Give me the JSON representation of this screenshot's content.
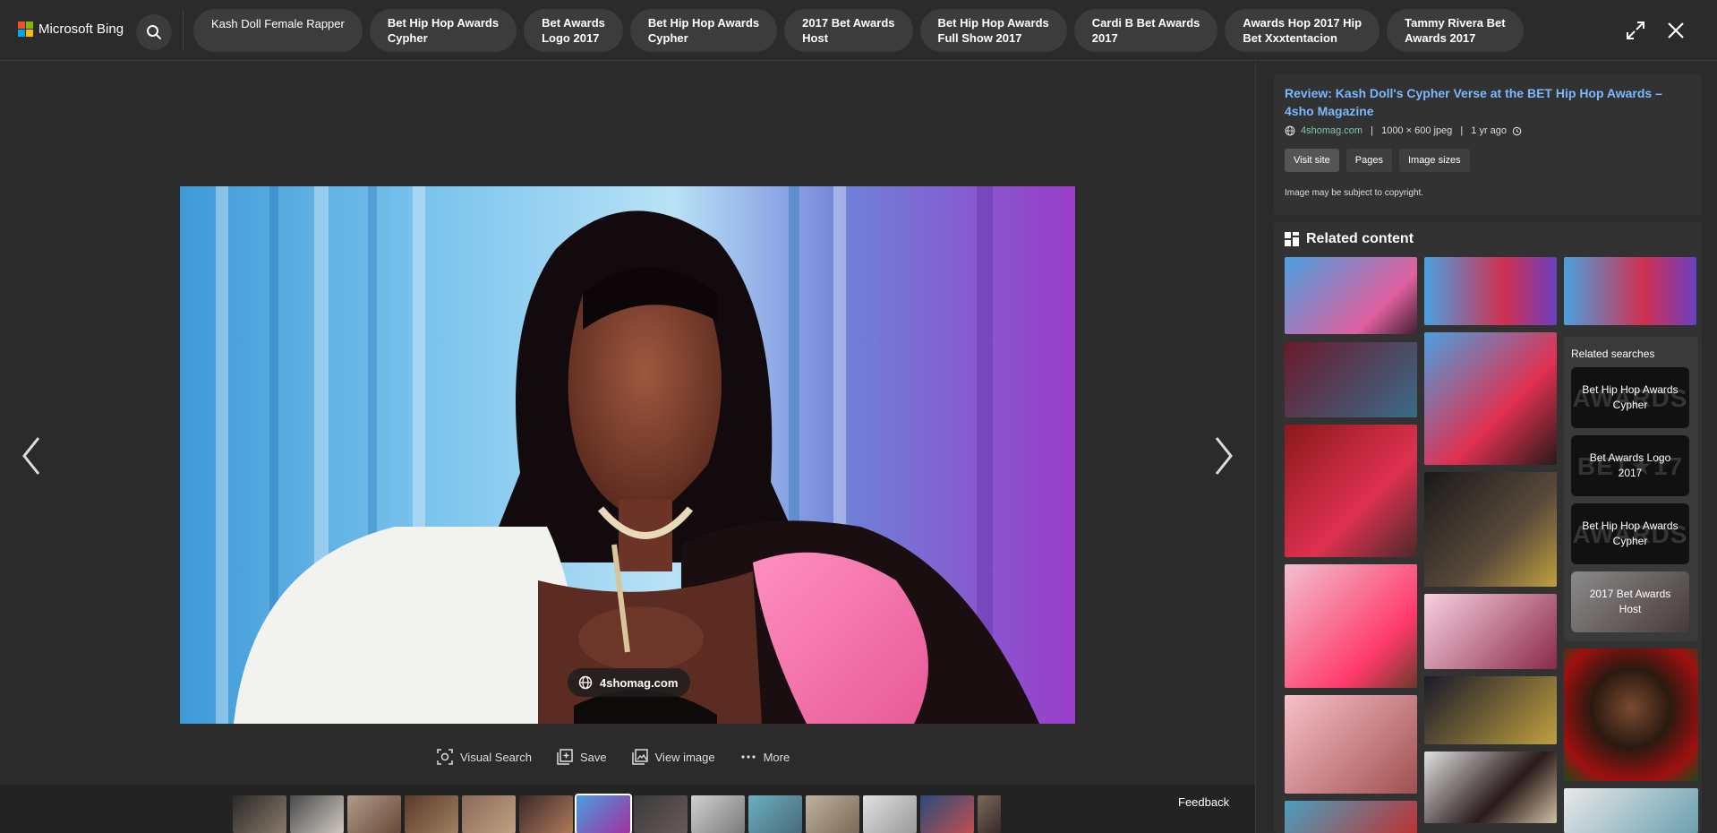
{
  "header": {
    "brand": "Microsoft Bing",
    "brand_colors": [
      "#f25022",
      "#7fba00",
      "#00a4ef",
      "#ffb900"
    ],
    "search_icon": "search-icon",
    "pills": [
      "Kash Doll Female Rapper",
      "Bet Hip Hop Awards\nCypher",
      "Bet Awards\nLogo 2017",
      "Bet Hip Hop Awards\nCypher",
      "2017 Bet Awards\nHost",
      "Bet Hip Hop Awards\nFull Show 2017",
      "Cardi B Bet Awards\n2017",
      "Awards Hop 2017 Hip\nBet Xxxtentacion",
      "Tammy Rivera Bet\nAwards 2017"
    ],
    "expand_icon": "expand-icon",
    "close_icon": "close-icon"
  },
  "viewer": {
    "source_badge": "4shomag.com",
    "actions": {
      "visual_search": "Visual Search",
      "save": "Save",
      "view_image": "View image",
      "more": "More"
    },
    "feedback": "Feedback"
  },
  "info": {
    "title": "Review: Kash Doll's Cypher Verse at the BET Hip Hop Awards – 4sho Magazine",
    "domain": "4shomag.com",
    "dimensions": "1000 × 600 jpeg",
    "age": "1 yr ago",
    "buttons": {
      "visit": "Visit site",
      "pages": "Pages",
      "sizes": "Image sizes"
    },
    "copyright": "Image may be subject to copyright."
  },
  "related": {
    "title": "Related content",
    "searches_title": "Related searches",
    "searches": [
      {
        "label": "Bet Hip Hop Awards Cypher",
        "watermark": "AWARDS"
      },
      {
        "label": "Bet Awards Logo 2017",
        "watermark": "BET★17"
      },
      {
        "label": "Bet Hip Hop Awards Cypher",
        "watermark": "AWARDS"
      },
      {
        "label": "2017 Bet Awards Host",
        "watermark": ""
      }
    ]
  },
  "colors": {
    "accent_link": "#7ab8ff",
    "domain_green": "#79c9a4",
    "panel_bg": "#323232",
    "page_bg": "#2b2b2b"
  }
}
